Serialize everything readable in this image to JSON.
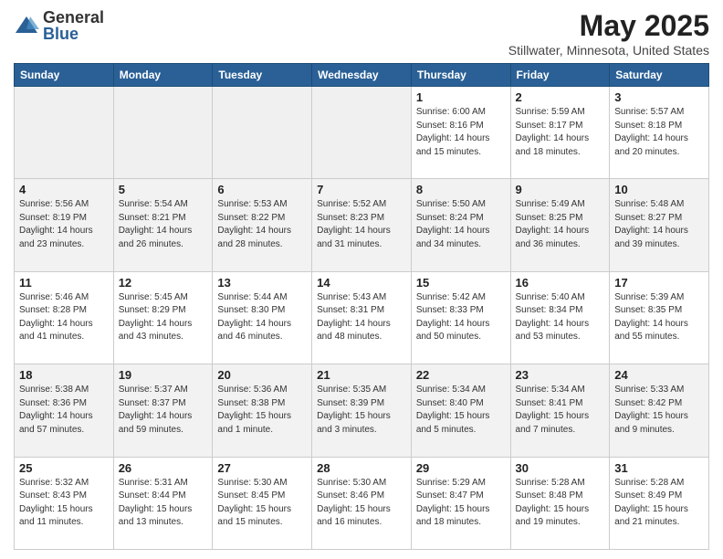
{
  "header": {
    "logo_general": "General",
    "logo_blue": "Blue",
    "month": "May 2025",
    "location": "Stillwater, Minnesota, United States"
  },
  "weekdays": [
    "Sunday",
    "Monday",
    "Tuesday",
    "Wednesday",
    "Thursday",
    "Friday",
    "Saturday"
  ],
  "weeks": [
    [
      {
        "day": "",
        "info": ""
      },
      {
        "day": "",
        "info": ""
      },
      {
        "day": "",
        "info": ""
      },
      {
        "day": "",
        "info": ""
      },
      {
        "day": "1",
        "info": "Sunrise: 6:00 AM\nSunset: 8:16 PM\nDaylight: 14 hours\nand 15 minutes."
      },
      {
        "day": "2",
        "info": "Sunrise: 5:59 AM\nSunset: 8:17 PM\nDaylight: 14 hours\nand 18 minutes."
      },
      {
        "day": "3",
        "info": "Sunrise: 5:57 AM\nSunset: 8:18 PM\nDaylight: 14 hours\nand 20 minutes."
      }
    ],
    [
      {
        "day": "4",
        "info": "Sunrise: 5:56 AM\nSunset: 8:19 PM\nDaylight: 14 hours\nand 23 minutes."
      },
      {
        "day": "5",
        "info": "Sunrise: 5:54 AM\nSunset: 8:21 PM\nDaylight: 14 hours\nand 26 minutes."
      },
      {
        "day": "6",
        "info": "Sunrise: 5:53 AM\nSunset: 8:22 PM\nDaylight: 14 hours\nand 28 minutes."
      },
      {
        "day": "7",
        "info": "Sunrise: 5:52 AM\nSunset: 8:23 PM\nDaylight: 14 hours\nand 31 minutes."
      },
      {
        "day": "8",
        "info": "Sunrise: 5:50 AM\nSunset: 8:24 PM\nDaylight: 14 hours\nand 34 minutes."
      },
      {
        "day": "9",
        "info": "Sunrise: 5:49 AM\nSunset: 8:25 PM\nDaylight: 14 hours\nand 36 minutes."
      },
      {
        "day": "10",
        "info": "Sunrise: 5:48 AM\nSunset: 8:27 PM\nDaylight: 14 hours\nand 39 minutes."
      }
    ],
    [
      {
        "day": "11",
        "info": "Sunrise: 5:46 AM\nSunset: 8:28 PM\nDaylight: 14 hours\nand 41 minutes."
      },
      {
        "day": "12",
        "info": "Sunrise: 5:45 AM\nSunset: 8:29 PM\nDaylight: 14 hours\nand 43 minutes."
      },
      {
        "day": "13",
        "info": "Sunrise: 5:44 AM\nSunset: 8:30 PM\nDaylight: 14 hours\nand 46 minutes."
      },
      {
        "day": "14",
        "info": "Sunrise: 5:43 AM\nSunset: 8:31 PM\nDaylight: 14 hours\nand 48 minutes."
      },
      {
        "day": "15",
        "info": "Sunrise: 5:42 AM\nSunset: 8:33 PM\nDaylight: 14 hours\nand 50 minutes."
      },
      {
        "day": "16",
        "info": "Sunrise: 5:40 AM\nSunset: 8:34 PM\nDaylight: 14 hours\nand 53 minutes."
      },
      {
        "day": "17",
        "info": "Sunrise: 5:39 AM\nSunset: 8:35 PM\nDaylight: 14 hours\nand 55 minutes."
      }
    ],
    [
      {
        "day": "18",
        "info": "Sunrise: 5:38 AM\nSunset: 8:36 PM\nDaylight: 14 hours\nand 57 minutes."
      },
      {
        "day": "19",
        "info": "Sunrise: 5:37 AM\nSunset: 8:37 PM\nDaylight: 14 hours\nand 59 minutes."
      },
      {
        "day": "20",
        "info": "Sunrise: 5:36 AM\nSunset: 8:38 PM\nDaylight: 15 hours\nand 1 minute."
      },
      {
        "day": "21",
        "info": "Sunrise: 5:35 AM\nSunset: 8:39 PM\nDaylight: 15 hours\nand 3 minutes."
      },
      {
        "day": "22",
        "info": "Sunrise: 5:34 AM\nSunset: 8:40 PM\nDaylight: 15 hours\nand 5 minutes."
      },
      {
        "day": "23",
        "info": "Sunrise: 5:34 AM\nSunset: 8:41 PM\nDaylight: 15 hours\nand 7 minutes."
      },
      {
        "day": "24",
        "info": "Sunrise: 5:33 AM\nSunset: 8:42 PM\nDaylight: 15 hours\nand 9 minutes."
      }
    ],
    [
      {
        "day": "25",
        "info": "Sunrise: 5:32 AM\nSunset: 8:43 PM\nDaylight: 15 hours\nand 11 minutes."
      },
      {
        "day": "26",
        "info": "Sunrise: 5:31 AM\nSunset: 8:44 PM\nDaylight: 15 hours\nand 13 minutes."
      },
      {
        "day": "27",
        "info": "Sunrise: 5:30 AM\nSunset: 8:45 PM\nDaylight: 15 hours\nand 15 minutes."
      },
      {
        "day": "28",
        "info": "Sunrise: 5:30 AM\nSunset: 8:46 PM\nDaylight: 15 hours\nand 16 minutes."
      },
      {
        "day": "29",
        "info": "Sunrise: 5:29 AM\nSunset: 8:47 PM\nDaylight: 15 hours\nand 18 minutes."
      },
      {
        "day": "30",
        "info": "Sunrise: 5:28 AM\nSunset: 8:48 PM\nDaylight: 15 hours\nand 19 minutes."
      },
      {
        "day": "31",
        "info": "Sunrise: 5:28 AM\nSunset: 8:49 PM\nDaylight: 15 hours\nand 21 minutes."
      }
    ]
  ]
}
